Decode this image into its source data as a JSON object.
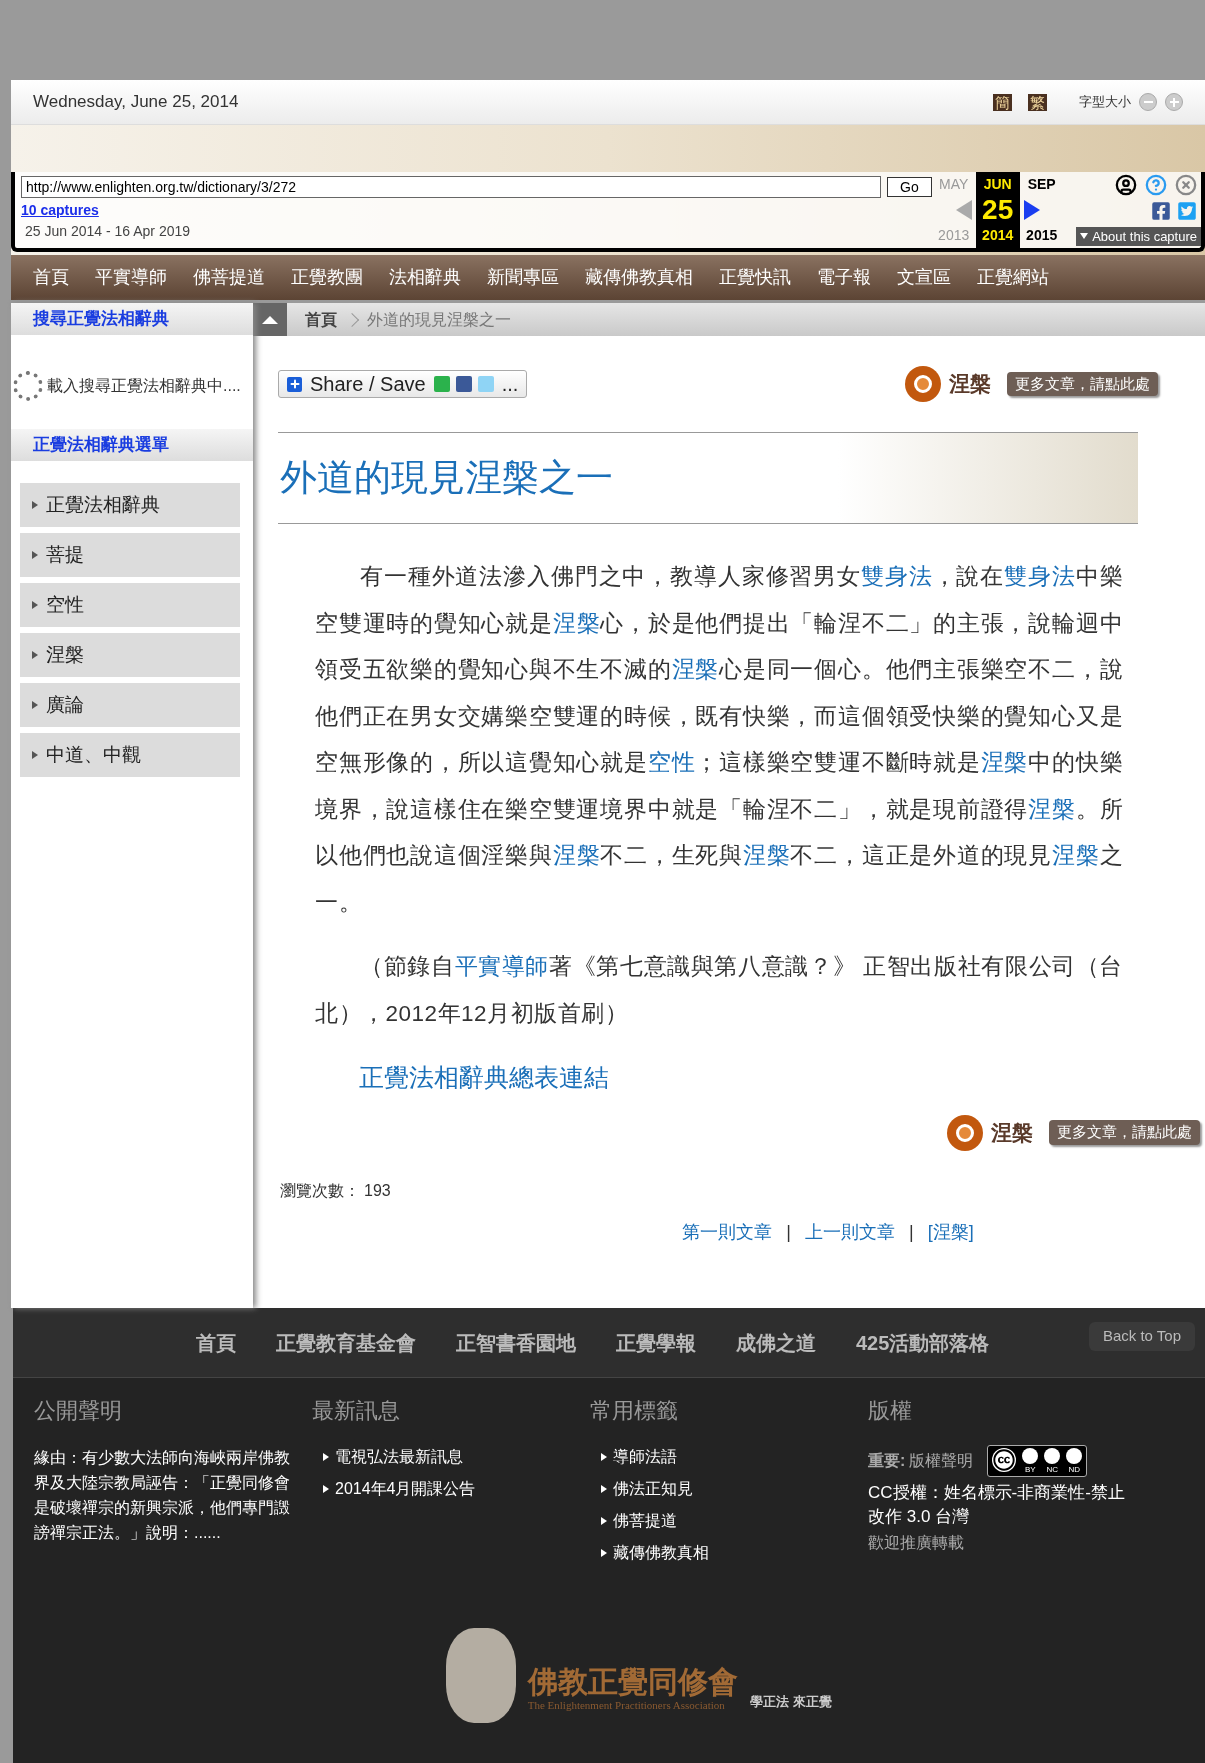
{
  "header": {
    "date": "Wednesday, June 25, 2014",
    "lang_buttons": [
      "簡",
      "繁"
    ],
    "font_size_label": "字型大小"
  },
  "wayback": {
    "url": "http://www.enlighten.org.tw/dictionary/3/272",
    "go": "Go",
    "captures": "10 captures",
    "range": "25 Jun 2014 - 16 Apr 2019",
    "about": "About this capture",
    "months": [
      {
        "label": "MAY",
        "year": "2013",
        "selected": false
      },
      {
        "label": "JUN",
        "day": "25",
        "year": "2014",
        "selected": true
      },
      {
        "label": "SEP",
        "year": "2015",
        "selected": false
      }
    ]
  },
  "nav": [
    "首頁",
    "平實導師",
    "佛菩提道",
    "正覺教團",
    "法相辭典",
    "新聞專區",
    "藏傳佛教真相",
    "正覺快訊",
    "電子報",
    "文宣區",
    "正覺網站"
  ],
  "sidebar": {
    "search_title": "搜尋正覺法相辭典",
    "loading_text": "載入搜尋正覺法相辭典中....",
    "menu_title": "正覺法相辭典選單",
    "items": [
      "正覺法相辭典",
      "菩提",
      "空性",
      "涅槃",
      "廣論",
      "中道、中觀"
    ]
  },
  "breadcrumb": [
    "首頁",
    "外道的現見涅槃之一"
  ],
  "share": {
    "label": "Share / Save",
    "more": "..."
  },
  "category_badges": [
    {
      "name": "涅槃",
      "more": "更多文章，請點此處"
    },
    {
      "name": "涅槃",
      "more": "更多文章，請點此處"
    }
  ],
  "title": "外道的現見涅槃之一",
  "paragraphs": [
    [
      {
        "text": "有一種外道法滲入佛門之中，教導人家修習男女",
        "link": false
      },
      {
        "text": "雙身法",
        "link": true
      },
      {
        "text": "，說在",
        "link": false
      },
      {
        "text": "雙身法",
        "link": true
      },
      {
        "text": "中樂空雙運時的覺知心就是",
        "link": false
      },
      {
        "text": "涅槃",
        "link": true
      },
      {
        "text": "心，於是他們提出「輪涅不二」的主張，說輪迴中領受五欲樂的覺知心與不生不滅的",
        "link": false
      },
      {
        "text": "涅槃",
        "link": true
      },
      {
        "text": "心是同一個心。他們主張樂空不二，說他們正在男女交媾樂空雙運的時候，既有快樂，而這個領受快樂的覺知心又是空無形像的，所以這覺知心就是",
        "link": false
      },
      {
        "text": "空性",
        "link": true
      },
      {
        "text": "；這樣樂空雙運不斷時就是",
        "link": false
      },
      {
        "text": "涅槃",
        "link": true
      },
      {
        "text": "中的快樂境界，說這樣住在樂空雙運境界中就是「輪涅不二」，就是現前證得",
        "link": false
      },
      {
        "text": "涅槃",
        "link": true
      },
      {
        "text": "。所以他們也說這個淫樂與",
        "link": false
      },
      {
        "text": "涅槃",
        "link": true
      },
      {
        "text": "不二，生死與",
        "link": false
      },
      {
        "text": "涅槃",
        "link": true
      },
      {
        "text": "不二，這正是外道的現見",
        "link": false
      },
      {
        "text": "涅槃",
        "link": true
      },
      {
        "text": "之一。",
        "link": false
      }
    ],
    [
      {
        "text": "（節錄自",
        "link": false
      },
      {
        "text": "平實導師",
        "link": true
      },
      {
        "text": "著《第七意識與第八意識？》 正智出版社有限公司（台北），2012年12月初版首刷）",
        "link": false
      }
    ]
  ],
  "index_link": "正覺法相辭典總表連結",
  "views": {
    "label": "瀏覽次數：",
    "count": "193"
  },
  "pager": [
    {
      "kind": "link",
      "text": "第一則文章"
    },
    {
      "kind": "separator",
      "text": "|"
    },
    {
      "kind": "link",
      "text": "上一則文章"
    },
    {
      "kind": "separator",
      "text": "|"
    },
    {
      "kind": "link",
      "text": "[涅槃]"
    }
  ],
  "footer": {
    "nav": [
      "首頁",
      "正覺教育基金會",
      "正智書香園地",
      "正覺學報",
      "成佛之道",
      "425活動部落格"
    ],
    "back_to_top": "Back to Top",
    "columns": [
      {
        "kind": "text",
        "title": "公開聲明",
        "text": "緣由：有少數大法師向海峽兩岸佛教界及大陸宗教局誣告：「正覺同修會是破壞禪宗的新興宗派，他們專門譭謗禪宗正法。」說明：......"
      },
      {
        "kind": "list",
        "title": "最新訊息",
        "items": [
          "電視弘法最新訊息",
          "2014年4月開課公告"
        ]
      },
      {
        "kind": "list",
        "title": "常用標籤",
        "items": [
          "導師法語",
          "佛法正知見",
          "佛菩提道",
          "藏傳佛教真相"
        ]
      },
      {
        "kind": "copyright",
        "title": "版權",
        "important": "重要:",
        "link": "版權聲明",
        "cc_labels": [
          "BY",
          "NC",
          "ND"
        ],
        "license": "CC授權：姓名標示-非商業性-禁止改作 3.0 台灣",
        "welcome": "歡迎推廣轉載"
      }
    ],
    "logo": {
      "name": "佛教正覺同修會",
      "english": "The Enlightenment Practitioners Association",
      "slogan": "學正法 來正覺"
    }
  }
}
